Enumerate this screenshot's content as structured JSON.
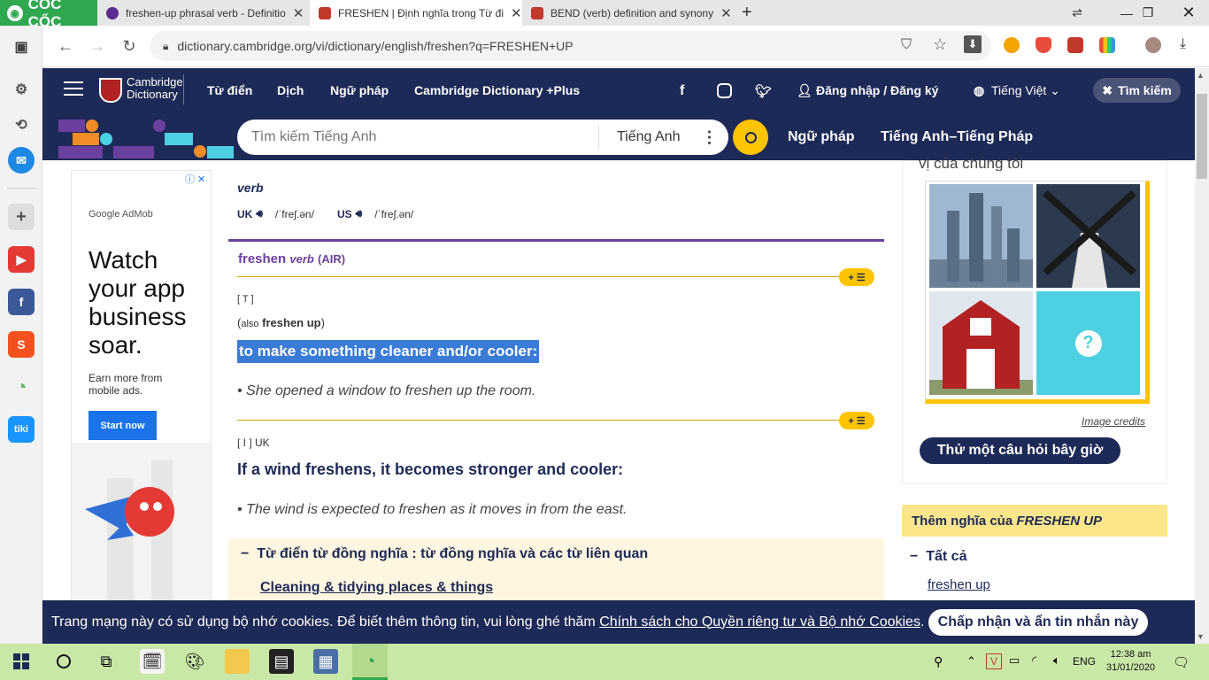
{
  "browser": {
    "brand": "CỐC CỐC",
    "tabs": [
      {
        "title": "freshen-up phrasal verb - Definitio",
        "color": "#5b2d8e"
      },
      {
        "title": "FRESHEN | Định nghĩa trong Từ đi",
        "color": "#c0392b"
      },
      {
        "title": "BEND (verb) definition and synony",
        "color": "#c0392b"
      }
    ],
    "url": "dictionary.cambridge.org/vi/dictionary/english/freshen?q=FRESHEN+UP"
  },
  "header": {
    "logo_line1": "Cambridge",
    "logo_line2": "Dictionary",
    "nav": [
      "Từ điển",
      "Dịch",
      "Ngữ pháp",
      "Cambridge Dictionary +Plus"
    ],
    "login": "Đăng nhập / Đăng ký",
    "language": "Tiếng Việt",
    "search_toggle": "Tìm kiếm"
  },
  "search": {
    "placeholder": "Tìm kiếm Tiếng Anh",
    "dictionary": "Tiếng Anh",
    "links": [
      "Ngữ pháp",
      "Tiếng Anh–Tiếng Pháp"
    ]
  },
  "entry": {
    "headword": "freshen",
    "pos": "verb",
    "uk_label": "UK",
    "uk_ipa": "/ˈfreʃ.ən/",
    "us_label": "US",
    "us_ipa": "/ˈfreʃ.ən/",
    "sense_head": "freshen",
    "sense_pos": "verb",
    "sense_domain": "(AIR)",
    "sense1_grammar": "[ T ]",
    "sense1_also_prefix": "also",
    "sense1_also_word": "freshen up",
    "sense1_def": "to make something cleaner and/or cooler:",
    "sense1_example": "She opened a window to freshen up the room.",
    "sense2_grammar": "[ I ] UK",
    "sense2_def": "If a wind freshens, it becomes stronger and cooler:",
    "sense2_example": "The wind is expected to freshen as it moves in from the east.",
    "thesaurus_title": "Từ điển từ đồng nghĩa : từ đồng nghĩa và các từ liên quan",
    "thesaurus_link": "Cleaning & tidying places & things",
    "pill_label": "+ ☰"
  },
  "ad": {
    "brand": "Google AdMob",
    "headline": "Watch your app business soar.",
    "sub": "Earn more from mobile ads.",
    "button": "Start now"
  },
  "right": {
    "top_text": "vị của chúng tôi",
    "image_credits": "Image credits",
    "quiz_button": "Thử một câu hỏi bây giờ",
    "more_title_prefix": "Thêm nghĩa của ",
    "more_title_word": "FRESHEN UP",
    "all_label": "Tất cả",
    "link": "freshen up"
  },
  "cookie": {
    "text": "Trang mạng này có sử dụng bộ nhớ cookies. Để biết thêm thông tin, vui lòng ghé thăm ",
    "link": "Chính sách cho Quyền riêng tư và Bộ nhớ Cookies",
    "period": ".",
    "button": "Chấp nhận và ẩn tin nhắn này"
  },
  "taskbar": {
    "lang": "ENG",
    "time": "12:38 am",
    "date": "31/01/2020"
  },
  "colors": {
    "cambridge_navy": "#1d2a57",
    "accent_yellow": "#fec400",
    "highlight_blue": "#3a7bd5",
    "purple": "#6b3fa0",
    "taskbar_green": "#c9e7a7"
  }
}
